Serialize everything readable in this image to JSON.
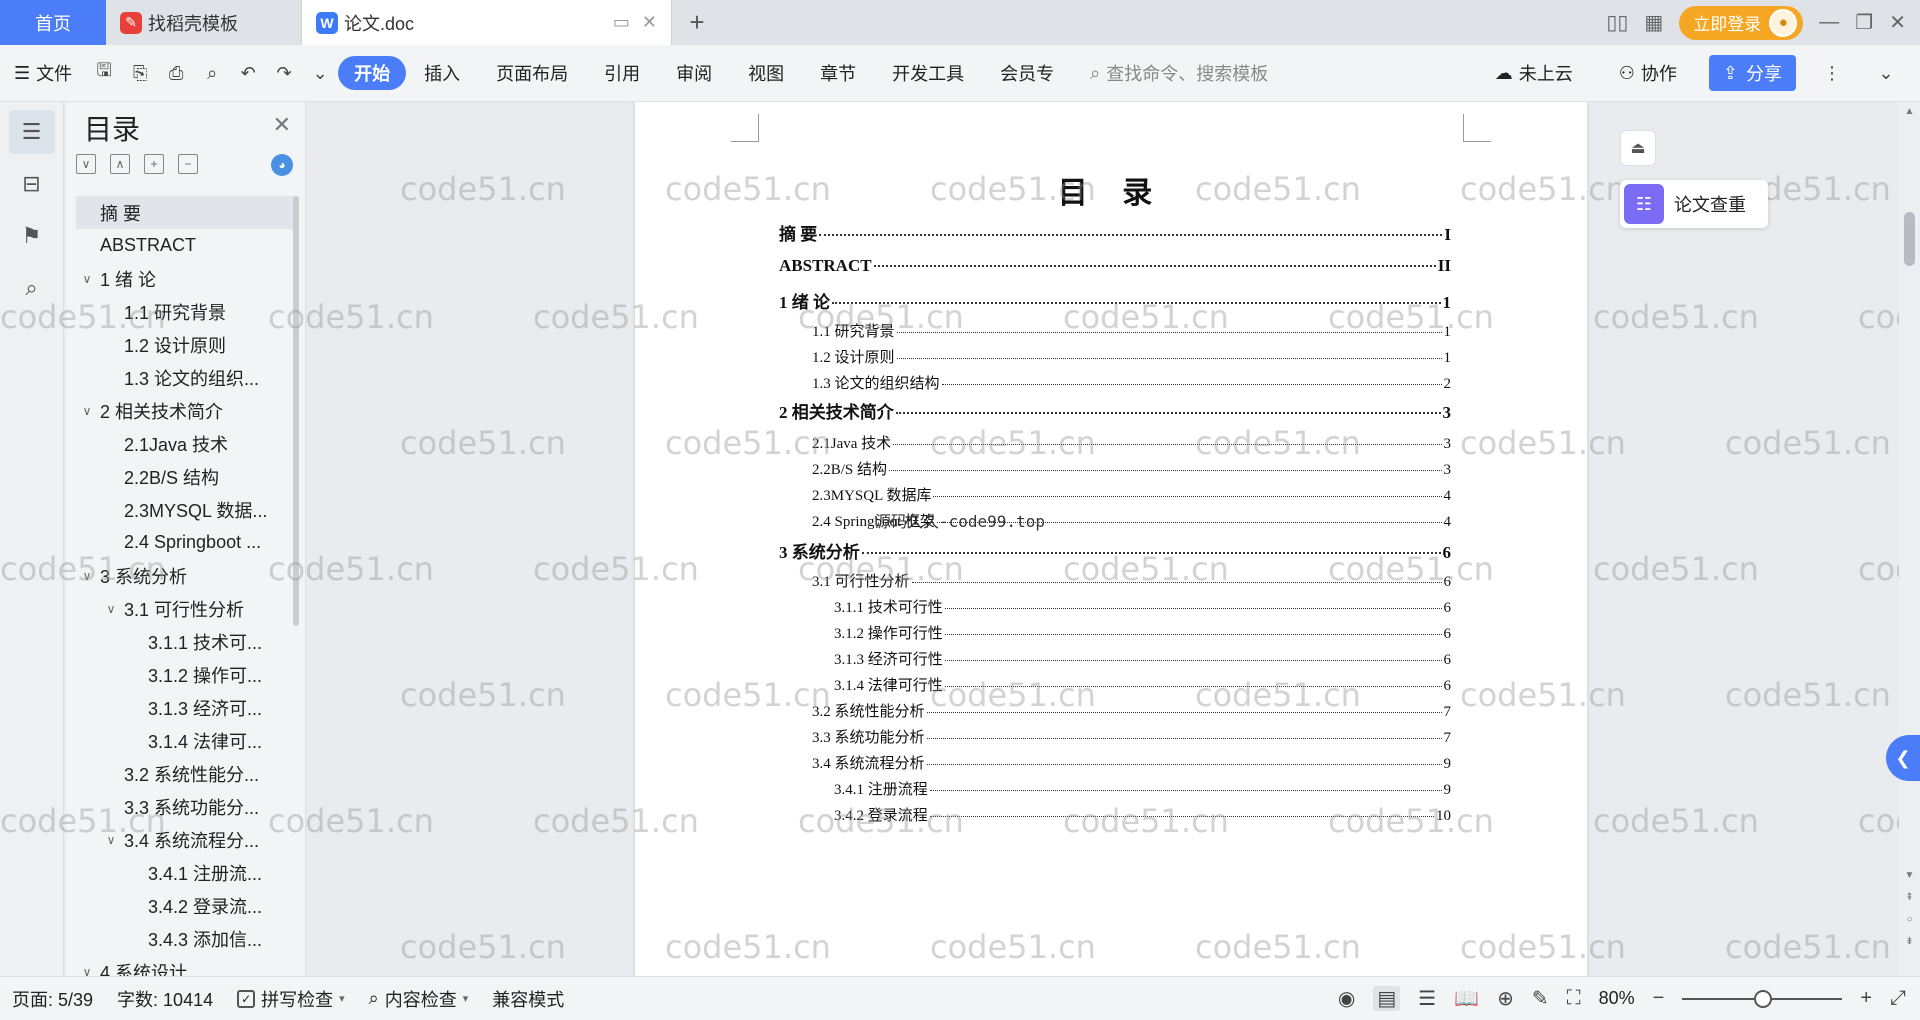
{
  "tabs": {
    "home": "首页",
    "docer": "找稻壳模板",
    "doc": "论文.doc",
    "new_tab": "+"
  },
  "titlebar": {
    "login": "立即登录"
  },
  "ribbon": {
    "file": "文件",
    "tabs": [
      "开始",
      "插入",
      "页面布局",
      "引用",
      "审阅",
      "视图",
      "章节",
      "开发工具",
      "会员专"
    ],
    "search": "查找命令、搜索模板",
    "cloud": "未上云",
    "collab": "协作",
    "share": "分享"
  },
  "toc_panel": {
    "title": "目录",
    "items": [
      {
        "label": "摘 要",
        "level": 1,
        "caret": "",
        "selected": true
      },
      {
        "label": "ABSTRACT",
        "level": 1,
        "caret": ""
      },
      {
        "label": "1 绪 论",
        "level": 1,
        "caret": "∨"
      },
      {
        "label": "1.1 研究背景",
        "level": 2,
        "caret": ""
      },
      {
        "label": "1.2 设计原则",
        "level": 2,
        "caret": ""
      },
      {
        "label": "1.3 论文的组织...",
        "level": 2,
        "caret": ""
      },
      {
        "label": "2  相关技术简介",
        "level": 1,
        "caret": "∨"
      },
      {
        "label": "2.1Java 技术",
        "level": 2,
        "caret": ""
      },
      {
        "label": "2.2B/S 结构",
        "level": 2,
        "caret": ""
      },
      {
        "label": "2.3MYSQL 数据...",
        "level": 2,
        "caret": ""
      },
      {
        "label": "2.4 Springboot ...",
        "level": 2,
        "caret": ""
      },
      {
        "label": "3  系统分析",
        "level": 1,
        "caret": "∨"
      },
      {
        "label": "3.1 可行性分析",
        "level": 2,
        "caret": "∨"
      },
      {
        "label": "3.1.1 技术可...",
        "level": 3,
        "caret": ""
      },
      {
        "label": "3.1.2 操作可...",
        "level": 3,
        "caret": ""
      },
      {
        "label": "3.1.3 经济可...",
        "level": 3,
        "caret": ""
      },
      {
        "label": "3.1.4 法律可...",
        "level": 3,
        "caret": ""
      },
      {
        "label": "3.2 系统性能分...",
        "level": 2,
        "caret": ""
      },
      {
        "label": "3.3 系统功能分...",
        "level": 2,
        "caret": ""
      },
      {
        "label": "3.4 系统流程分...",
        "level": 2,
        "caret": "∨"
      },
      {
        "label": "3.4.1 注册流...",
        "level": 3,
        "caret": ""
      },
      {
        "label": "3.4.2 登录流...",
        "level": 3,
        "caret": ""
      },
      {
        "label": "3.4.3 添加信...",
        "level": 3,
        "caret": ""
      },
      {
        "label": "4 系统设计",
        "level": 1,
        "caret": "∨"
      }
    ]
  },
  "document": {
    "title": "目 录",
    "inline_watermark": "源码久久-code99.top",
    "entries": [
      {
        "text": "摘  要",
        "page": "I",
        "level": 1
      },
      {
        "text": "ABSTRACT",
        "page": "II",
        "level": 1
      },
      {
        "text": "1 绪  论",
        "page": "1",
        "level": 1
      },
      {
        "text": "1.1 研究背景",
        "page": "1",
        "level": 2
      },
      {
        "text": "1.2 设计原则",
        "page": "1",
        "level": 2
      },
      {
        "text": "1.3 论文的组织结构",
        "page": "2",
        "level": 2
      },
      {
        "text": "2  相关技术简介",
        "page": "3",
        "level": 1
      },
      {
        "text": "2.1Java 技术",
        "page": "3",
        "level": 2
      },
      {
        "text": "2.2B/S 结构",
        "page": "3",
        "level": 2
      },
      {
        "text": "2.3MYSQL 数据库",
        "page": "4",
        "level": 2
      },
      {
        "text": "2.4 Springboot 框架",
        "page": "4",
        "level": 2
      },
      {
        "text": "3  系统分析",
        "page": "6",
        "level": 1
      },
      {
        "text": "3.1 可行性分析",
        "page": "6",
        "level": 2
      },
      {
        "text": "3.1.1 技术可行性",
        "page": "6",
        "level": 3
      },
      {
        "text": "3.1.2 操作可行性",
        "page": "6",
        "level": 3
      },
      {
        "text": "3.1.3 经济可行性",
        "page": "6",
        "level": 3
      },
      {
        "text": "3.1.4 法律可行性",
        "page": "6",
        "level": 3
      },
      {
        "text": "3.2 系统性能分析",
        "page": "7",
        "level": 2
      },
      {
        "text": "3.3 系统功能分析",
        "page": "7",
        "level": 2
      },
      {
        "text": "3.4 系统流程分析",
        "page": "9",
        "level": 2
      },
      {
        "text": "3.4.1 注册流程",
        "page": "9",
        "level": 3
      },
      {
        "text": "3.4.2 登录流程",
        "page": "10",
        "level": 3
      }
    ]
  },
  "float_panel": {
    "check": "论文查重"
  },
  "watermark": "code51.cn",
  "statusbar": {
    "page": "页面: 5/39",
    "words": "字数: 10414",
    "spell": "拼写检查",
    "content": "内容检查",
    "compat": "兼容模式",
    "zoom": "80%"
  },
  "colors": {
    "accent": "#4a7df7",
    "login": "#f5a623",
    "check_icon": "#7b6cf6"
  }
}
